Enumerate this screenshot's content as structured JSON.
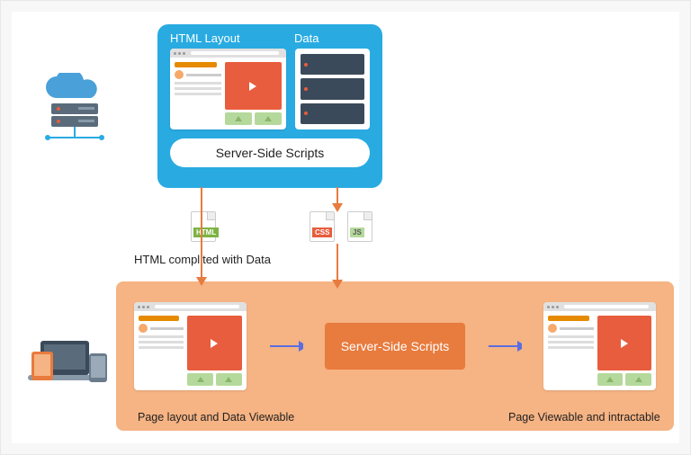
{
  "server": {
    "html_label": "HTML Layout",
    "data_label": "Data",
    "scripts_label": "Server-Side Scripts"
  },
  "files": {
    "html": "HTML",
    "css": "CSS",
    "js": "JS"
  },
  "captions": {
    "compiled": "HTML complited with Data",
    "page_layout": "Page layout and Data Viewable",
    "page_viewable": "Page Viewable and intractable"
  },
  "client": {
    "scripts_label": "Server-Side Scripts"
  }
}
